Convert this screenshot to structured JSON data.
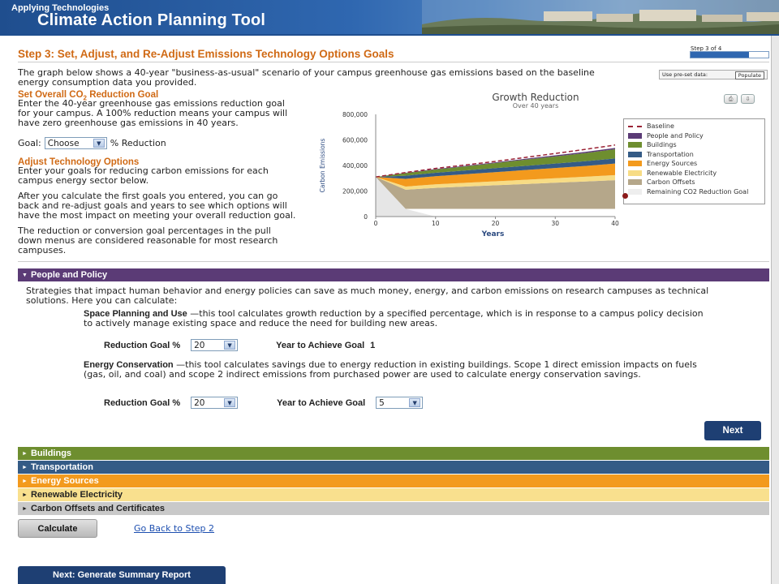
{
  "banner": {
    "subtitle": "Applying Technologies",
    "title": "Climate Action Planning Tool"
  },
  "step": {
    "title": "Step 3: Set, Adjust, and Re-Adjust Emissions Technology Options Goals",
    "progress_label": "Step 3 of 4",
    "progress_fraction": 0.75
  },
  "intro": "The graph below shows a 40-year \"business-as-usual\" scenario of your campus greenhouse gas emissions based on the baseline energy consumption data you provided.",
  "preset": {
    "label": "Use pre-set data:",
    "button": "Populate"
  },
  "set_goal": {
    "heading_prefix": "Set Overall CO",
    "heading_sub": "2",
    "heading_suffix": " Reduction Goal",
    "text": "Enter the 40-year greenhouse gas emissions reduction goal for your campus. A 100% reduction means your campus will have zero greenhouse gas emissions in 40 years.",
    "goal_label": "Goal:",
    "goal_value": "Choose",
    "goal_suffix": "% Reduction"
  },
  "adjust": {
    "heading": "Adjust Technology Options",
    "p1": "Enter your goals for reducing carbon emissions for each campus energy sector below.",
    "p2": "After you calculate the first goals you entered, you can go back and re-adjust goals and years to see which options will have the most impact on meeting your overall reduction goal.",
    "p3": "The reduction or conversion goal percentages in the pull down menus are considered reasonable for most research campuses."
  },
  "chart_icons": [
    "print-icon",
    "download-icon"
  ],
  "chart_data": {
    "type": "area",
    "title": "Growth Reduction",
    "subtitle": "Over 40 years",
    "xlabel": "Years",
    "ylabel": "Carbon Emissions",
    "xlim": [
      0,
      40
    ],
    "ylim": [
      0,
      800000
    ],
    "x_ticks": [
      0,
      10,
      20,
      30,
      40
    ],
    "y_ticks": [
      0,
      200000,
      400000,
      600000,
      800000
    ],
    "y_tick_labels": [
      "0",
      "200,000",
      "400,000",
      "600,000",
      "800,000"
    ],
    "x": [
      0,
      5,
      10,
      15,
      20,
      25,
      30,
      35,
      40
    ],
    "stack_base": [
      310000,
      60000,
      60000,
      60000,
      60000,
      60000,
      60000,
      60000,
      60000
    ],
    "series": [
      {
        "name": "Carbon Offsets",
        "color": "#b5a78a",
        "values": [
          0,
          150000,
          165000,
          175000,
          185000,
          195000,
          205000,
          215000,
          225000
        ]
      },
      {
        "name": "Renewable Electricity",
        "color": "#f7dc85",
        "values": [
          0,
          25000,
          27000,
          29000,
          31000,
          33000,
          35000,
          37000,
          40000
        ]
      },
      {
        "name": "Energy Sources",
        "color": "#f39a1d",
        "values": [
          0,
          60000,
          64000,
          68000,
          72000,
          76000,
          80000,
          84000,
          90000
        ]
      },
      {
        "name": "Transportation",
        "color": "#345b86",
        "values": [
          0,
          25000,
          27000,
          29000,
          31000,
          33000,
          35000,
          37000,
          40000
        ]
      },
      {
        "name": "Buildings",
        "color": "#6e8e2f",
        "values": [
          0,
          20000,
          25000,
          32000,
          40000,
          48000,
          56000,
          64000,
          72000
        ]
      },
      {
        "name": "People and Policy",
        "color": "#5b3b76",
        "values": [
          0,
          3000,
          4000,
          5000,
          6000,
          7000,
          8000,
          9000,
          10000
        ]
      }
    ],
    "baseline": {
      "name": "Baseline",
      "color": "#9b2335",
      "values": [
        310000,
        345000,
        377000,
        404000,
        432000,
        463000,
        494000,
        526000,
        560000
      ]
    },
    "remaining": {
      "name": "Remaining CO2 Reduction Goal",
      "color": "#e6e6e6",
      "values": [
        310000,
        60000,
        0,
        0,
        0,
        0,
        0,
        0,
        0
      ]
    },
    "legend": [
      {
        "label": "Baseline",
        "color": "#9b2335",
        "style": "dash"
      },
      {
        "label": "People and Policy",
        "color": "#5b3b76",
        "style": "fill"
      },
      {
        "label": "Buildings",
        "color": "#6e8e2f",
        "style": "fill"
      },
      {
        "label": "Transportation",
        "color": "#345b86",
        "style": "fill"
      },
      {
        "label": "Energy Sources",
        "color": "#f39a1d",
        "style": "fill"
      },
      {
        "label": "Renewable Electricity",
        "color": "#f7dc85",
        "style": "fill"
      },
      {
        "label": "Carbon Offsets",
        "color": "#b5a78a",
        "style": "fill"
      },
      {
        "label": "Remaining CO2 Reduction Goal",
        "color": "#eeeeee",
        "style": "fill"
      }
    ],
    "legend_position": "right",
    "grid": false
  },
  "people": {
    "bar_label": "People and Policy",
    "intro": "Strategies that impact human behavior and energy policies can save as much money, energy, and carbon emissions on research campuses as technical solutions. Here you can calculate:",
    "space": {
      "name": "Space Planning and Use",
      "desc": " —this tool calculates growth reduction by a specified percentage, which is in response to a campus policy decision to actively manage existing space and reduce the need for building new areas.",
      "goal_label": "Reduction Goal %",
      "goal_value": "20",
      "year_label": "Year to Achieve Goal",
      "year_value": "1"
    },
    "energy": {
      "name": "Energy Conservation",
      "desc": " —this tool calculates savings due to energy reduction in existing buildings. Scope 1 direct emission impacts on fuels (gas, oil, and coal) and scope 2 indirect emissions from purchased power are used to calculate energy conservation savings.",
      "goal_label": "Reduction Goal %",
      "goal_value": "20",
      "year_label": "Year to Achieve Goal",
      "year_value": "5"
    },
    "next_label": "Next"
  },
  "sections": {
    "buildings": "Buildings",
    "transportation": "Transportation",
    "energy_sources": "Energy Sources",
    "renewable": "Renewable Electricity",
    "offsets": "Carbon Offsets and Certificates"
  },
  "actions": {
    "calculate": "Calculate",
    "back": "Go Back to Step 2",
    "summary": "Next: Generate Summary Report"
  }
}
